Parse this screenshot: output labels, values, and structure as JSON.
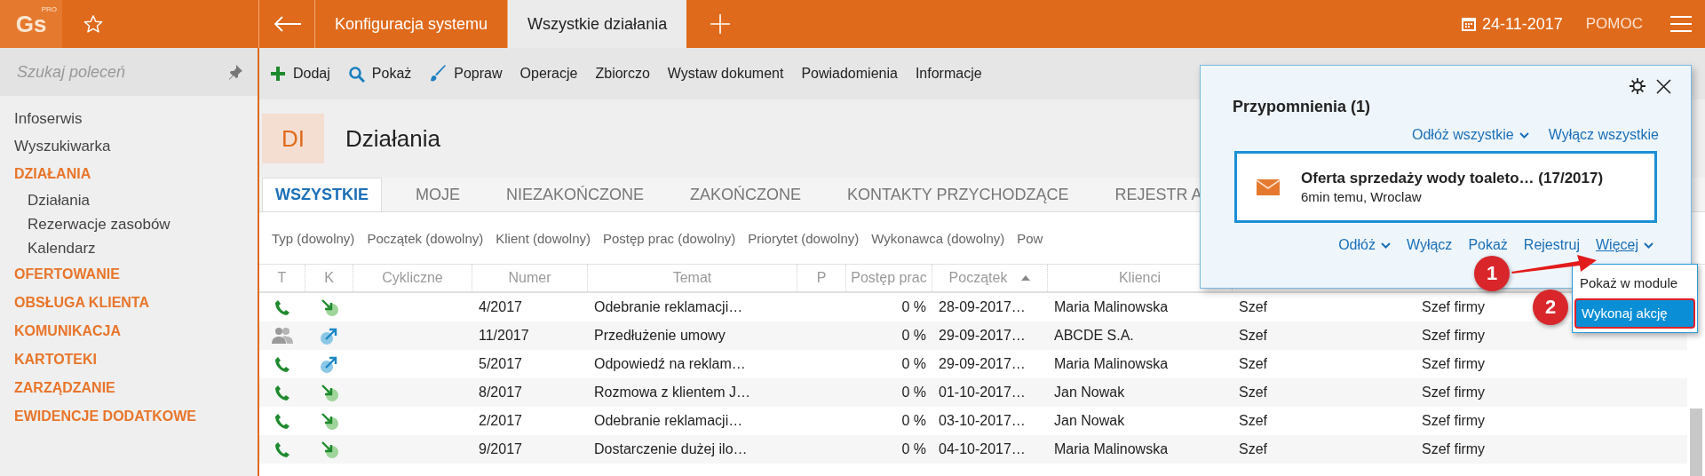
{
  "app": {
    "logo": "Gs",
    "logo_badge": "PRO"
  },
  "top_tabs": [
    {
      "label": "Konfiguracja systemu",
      "selected": false
    },
    {
      "label": "Wszystkie działania",
      "selected": true
    }
  ],
  "date": "24-11-2017",
  "help": "POMOC",
  "sidebar": {
    "search": {
      "placeholder": "Szukaj poleceń"
    },
    "items": [
      {
        "label": "Infoserwis",
        "kind": "link"
      },
      {
        "label": "Wyszukiwarka",
        "kind": "link"
      },
      {
        "label": "DZIAŁANIA",
        "kind": "section",
        "children": [
          {
            "label": "Działania"
          },
          {
            "label": "Rezerwacje zasobów"
          },
          {
            "label": "Kalendarz"
          }
        ]
      },
      {
        "label": "OFERTOWANIE",
        "kind": "section"
      },
      {
        "label": "OBSŁUGA KLIENTA",
        "kind": "section"
      },
      {
        "label": "KOMUNIKACJA",
        "kind": "section"
      },
      {
        "label": "KARTOTEKI",
        "kind": "section"
      },
      {
        "label": "ZARZĄDZANIE",
        "kind": "section"
      },
      {
        "label": "EWIDENCJE DODATKOWE",
        "kind": "section"
      }
    ]
  },
  "toolbar": [
    {
      "label": "Dodaj",
      "kind": "plus"
    },
    {
      "label": "Pokaż",
      "kind": "search"
    },
    {
      "label": "Popraw",
      "kind": "brush"
    },
    {
      "label": "Operacje",
      "kind": "text"
    },
    {
      "label": "Zbiorczo",
      "kind": "text"
    },
    {
      "label": "Wystaw dokument",
      "kind": "text"
    },
    {
      "label": "Powiadomienia",
      "kind": "text"
    },
    {
      "label": "Informacje",
      "kind": "text"
    }
  ],
  "module": {
    "badge": "DI",
    "title": "Działania"
  },
  "tabs": [
    {
      "label": "WSZYSTKIE",
      "selected": true
    },
    {
      "label": "MOJE",
      "selected": false
    },
    {
      "label": "NIEZAKOŃCZONE",
      "selected": false
    },
    {
      "label": "ZAKOŃCZONE",
      "selected": false
    },
    {
      "label": "KONTAKTY PRZYCHODZĄCE",
      "selected": false
    },
    {
      "label": "REJESTR A",
      "selected": false
    }
  ],
  "filters": [
    "Typ (dowolny)",
    "Początek (dowolny)",
    "Klient (dowolny)",
    "Postęp prac (dowolny)",
    "Priorytet (dowolny)",
    "Wykonawca (dowolny)",
    "Pow"
  ],
  "table": {
    "columns": [
      {
        "label": "T",
        "sorted": false
      },
      {
        "label": "K",
        "sorted": false
      },
      {
        "label": "Cykliczne",
        "sorted": false
      },
      {
        "label": "Numer",
        "sorted": false
      },
      {
        "label": "Temat",
        "sorted": false
      },
      {
        "label": "P",
        "sorted": false
      },
      {
        "label": "Postęp prac",
        "sorted": false
      },
      {
        "label": "Początek",
        "sorted": true
      },
      {
        "label": "Klienci",
        "sorted": false
      }
    ],
    "rows": [
      {
        "t": {
          "kind": "phone"
        },
        "k": {
          "kind": "in"
        },
        "number": "4/2017",
        "subject": "Odebranie reklamacji…",
        "progress": "0 %",
        "start": "28-09-2017…",
        "client": "Maria Malinowska",
        "column_10": "Szef",
        "column_11": "Szef firmy"
      },
      {
        "t": {
          "kind": "people"
        },
        "k": {
          "kind": "out"
        },
        "number": "11/2017",
        "subject": "Przedłużenie umowy",
        "progress": "0 %",
        "start": "29-09-2017…",
        "client": "ABCDE S.A.",
        "column_10": "Szef",
        "column_11": "Szef firmy"
      },
      {
        "t": {
          "kind": "phone"
        },
        "k": {
          "kind": "out"
        },
        "number": "5/2017",
        "subject": "Odpowiedź na reklam…",
        "progress": "0 %",
        "start": "29-09-2017…",
        "client": "Maria Malinowska",
        "column_10": "Szef",
        "column_11": "Szef firmy"
      },
      {
        "t": {
          "kind": "phone"
        },
        "k": {
          "kind": "in"
        },
        "number": "8/2017",
        "subject": "Rozmowa z klientem J…",
        "progress": "0 %",
        "start": "01-10-2017…",
        "client": "Jan Nowak",
        "column_10": "Szef",
        "column_11": "Szef firmy"
      },
      {
        "t": {
          "kind": "phone"
        },
        "k": {
          "kind": "in"
        },
        "number": "2/2017",
        "subject": "Odebranie reklamacji…",
        "progress": "0 %",
        "start": "03-10-2017…",
        "client": "Jan Nowak",
        "column_10": "Szef",
        "column_11": "Szef firmy"
      },
      {
        "t": {
          "kind": "phone"
        },
        "k": {
          "kind": "in"
        },
        "number": "9/2017",
        "subject": "Dostarczenie dużej ilo…",
        "progress": "0 %",
        "start": "04-10-2017…",
        "client": "Maria Malinowska",
        "column_10": "Szef",
        "column_11": "Szef firmy"
      }
    ]
  },
  "popup": {
    "title": "Przypomnienia (1)",
    "header_links": [
      {
        "label": "Odłóż wszystkie",
        "dropdown": true
      },
      {
        "label": "Wyłącz wszystkie",
        "dropdown": false
      }
    ],
    "reminder": {
      "kind": "mail",
      "title": "Oferta sprzedaży wody toaleto… (17/2017)",
      "detail": "6min temu, Wroclaw"
    },
    "actions": [
      {
        "label": "Odłóż",
        "dropdown": true,
        "underlined": false
      },
      {
        "label": "Wyłącz",
        "dropdown": false,
        "underlined": false
      },
      {
        "label": "Pokaż",
        "dropdown": false,
        "underlined": false
      },
      {
        "label": "Rejestruj",
        "dropdown": false,
        "underlined": false
      },
      {
        "label": "Więcej",
        "dropdown": true,
        "underlined": true
      }
    ],
    "menu": [
      {
        "label": "Pokaż w module",
        "selected": false
      },
      {
        "label": "Wykonaj akcję",
        "selected": true
      }
    ]
  },
  "annotations": [
    {
      "label": "1"
    },
    {
      "label": "2"
    }
  ]
}
